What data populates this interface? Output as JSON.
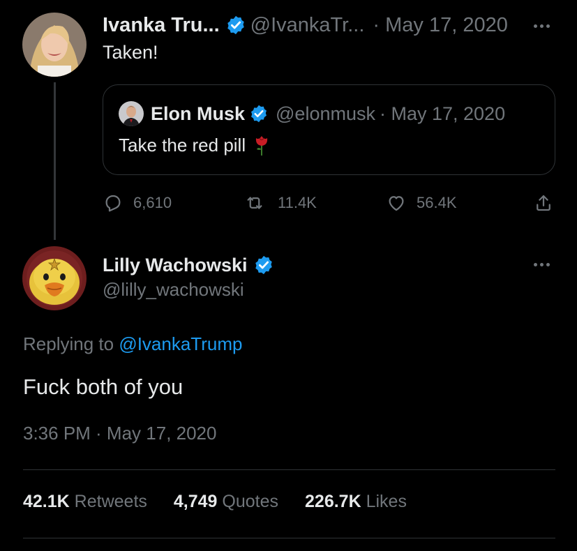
{
  "colors": {
    "background": "#000000",
    "text_primary": "#e7e9ea",
    "text_secondary": "#71767b",
    "accent_blue": "#1d9bf0",
    "border": "#2f3336"
  },
  "parent_tweet": {
    "author_name": "Ivanka Tru...",
    "author_handle": "@IvankaTr...",
    "date": "· May 17, 2020",
    "text": "Taken!",
    "avatar_icon": "ivanka-avatar",
    "quote": {
      "author_name": "Elon Musk",
      "author_handle": "@elonmusk",
      "date": "· May 17, 2020",
      "text": "Take the red pill",
      "emoji_icon": "rose-icon"
    },
    "actions": {
      "replies": "6,610",
      "retweets": "11.4K",
      "likes": "56.4K"
    }
  },
  "reply_tweet": {
    "author_name": "Lilly Wachowski",
    "author_handle": "@lilly_wachowski",
    "avatar_icon": "duck-avatar",
    "replying_to_label": "Replying to",
    "replying_to_handle": "@IvankaTrump",
    "text": "Fuck both of you",
    "timestamp": "3:36 PM · May 17, 2020",
    "stats": {
      "retweets_count": "42.1K",
      "retweets_label": "Retweets",
      "quotes_count": "4,749",
      "quotes_label": "Quotes",
      "likes_count": "226.7K",
      "likes_label": "Likes"
    }
  }
}
